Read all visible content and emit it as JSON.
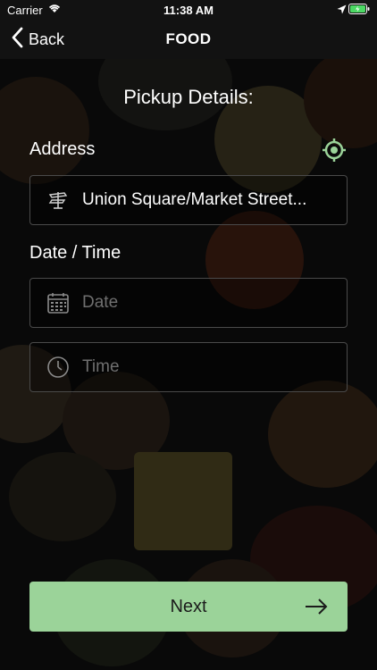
{
  "status_bar": {
    "carrier": "Carrier",
    "time": "11:38 AM"
  },
  "nav": {
    "back_label": "Back",
    "title": "FOOD"
  },
  "form": {
    "heading": "Pickup Details:",
    "address_label": "Address",
    "address_value": "Union Square/Market Street...",
    "datetime_label": "Date / Time",
    "date_placeholder": "Date",
    "time_placeholder": "Time"
  },
  "actions": {
    "next_label": "Next"
  },
  "colors": {
    "accent": "#9bd399",
    "field_border": "#4a4a4a",
    "placeholder": "#6f6f6f"
  },
  "icons": {
    "back": "chevron-left-icon",
    "wifi": "wifi-icon",
    "location": "location-arrow-icon",
    "battery": "battery-icon",
    "locate": "target-icon",
    "address": "signpost-icon",
    "date": "calendar-icon",
    "time": "clock-icon",
    "next": "arrow-right-icon"
  }
}
